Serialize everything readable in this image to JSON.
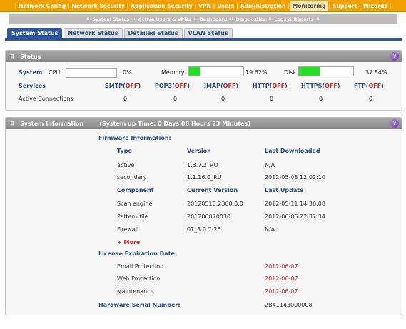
{
  "topnav": {
    "items": [
      "Network Config",
      "Network Security",
      "Application Security",
      "VPN",
      "Users",
      "Administration",
      "Monitoring",
      "Support",
      "Wizards"
    ],
    "active": "Monitoring"
  },
  "subnav": {
    "items": [
      "System Status",
      "Active Users & VPNs",
      "Dashboard",
      "Diagnostics",
      "Logs & Reports"
    ],
    "separator": "::"
  },
  "tabs": [
    "System Status",
    "Network Status",
    "Detailed Status",
    "VLAN Status"
  ],
  "status_panel": {
    "title": "Status",
    "help": "?",
    "system_label": "System",
    "cpu": {
      "label": "CPU",
      "value": "0%",
      "fraction": 0.0
    },
    "memory": {
      "label": "Memory",
      "value": "19.62%",
      "fraction": 0.1962
    },
    "disk": {
      "label": "Disk",
      "value": "37.84%",
      "fraction": 0.3784
    },
    "services_label": "Services",
    "services": [
      {
        "name": "SMTP",
        "state": "OFF",
        "count": "0"
      },
      {
        "name": "POP3",
        "state": "OFF",
        "count": "0"
      },
      {
        "name": "IMAP",
        "state": "OFF",
        "count": "0"
      },
      {
        "name": "HTTP",
        "state": "OFF",
        "count": "0"
      },
      {
        "name": "HTTPS",
        "state": "OFF",
        "count": "0"
      },
      {
        "name": "FTP",
        "state": "OFF",
        "count": "0"
      }
    ],
    "active_connections_label": "Active Connections"
  },
  "sysinfo_panel": {
    "title": "System Information",
    "uptime": "(System up Time: 0 Days 00 Hours 23 Minutes)",
    "help": "?",
    "firmware_label": "Firmware Information:",
    "fw_headers": [
      "Type",
      "Version",
      "Last Downloaded"
    ],
    "fw_rows": [
      [
        "active",
        "1.3.7.2_RU",
        "N/A"
      ],
      [
        "secondary",
        "1.1.16.0_RU",
        "2012-05-08 12:02:10"
      ]
    ],
    "comp_headers": [
      "Component",
      "Current Version",
      "Last Update"
    ],
    "comp_rows": [
      [
        "Scan engine",
        "20120510.2300.0.0",
        "2012-05-11 14:36:08"
      ],
      [
        "Pattern file",
        "201206070030",
        "2012-06-06 22:37:34"
      ],
      [
        "Firewall",
        "01_3.0.7-26",
        "N/A"
      ]
    ],
    "more_label": "+ More",
    "license_label": "License Expiration Date:",
    "licenses": [
      [
        "Email Protection",
        "2012-06-07"
      ],
      [
        "Web Protection",
        "2012-06-07"
      ],
      [
        "Maintenance",
        "2012-06-07"
      ]
    ],
    "serial_label": "Hardware Serial Number:",
    "serial": "2B41143000008"
  }
}
